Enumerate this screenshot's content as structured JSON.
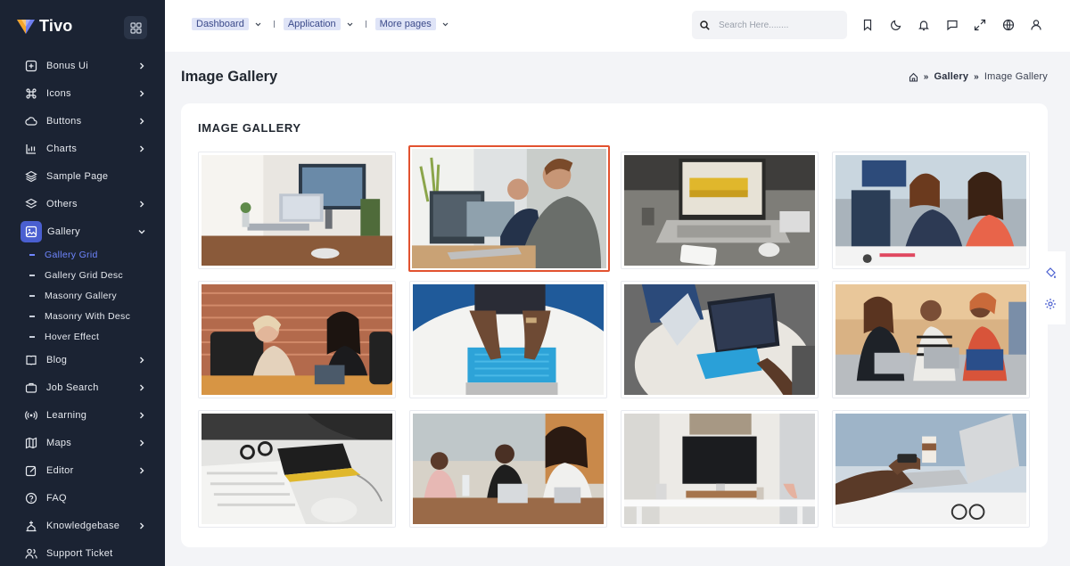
{
  "brand": {
    "name": "Tivo"
  },
  "sidebar": {
    "items": [
      {
        "label": "Bonus Ui",
        "icon": "bonus-ui-icon",
        "chevron": true
      },
      {
        "label": "Icons",
        "icon": "command-icon",
        "chevron": true
      },
      {
        "label": "Buttons",
        "icon": "cloud-icon",
        "chevron": true
      },
      {
        "label": "Charts",
        "icon": "chart-icon",
        "chevron": true
      },
      {
        "label": "Sample Page",
        "icon": "layers-icon",
        "chevron": false
      },
      {
        "label": "Others",
        "icon": "stack-icon",
        "chevron": true
      },
      {
        "label": "Gallery",
        "icon": "image-icon",
        "chevron": true,
        "expanded": true
      }
    ],
    "gallery_sub": [
      {
        "label": "Gallery Grid",
        "active": true
      },
      {
        "label": "Gallery Grid Desc"
      },
      {
        "label": "Masonry Gallery"
      },
      {
        "label": "Masonry With Desc"
      },
      {
        "label": "Hover Effect"
      }
    ],
    "items_after": [
      {
        "label": "Blog",
        "icon": "book-icon",
        "chevron": true
      },
      {
        "label": "Job Search",
        "icon": "briefcase-icon",
        "chevron": true
      },
      {
        "label": "Learning",
        "icon": "broadcast-icon",
        "chevron": true
      },
      {
        "label": "Maps",
        "icon": "map-icon",
        "chevron": true
      },
      {
        "label": "Editor",
        "icon": "edit-icon",
        "chevron": true
      },
      {
        "label": "FAQ",
        "icon": "help-icon",
        "chevron": false
      },
      {
        "label": "Knowledgebase",
        "icon": "knowledge-icon",
        "chevron": true
      },
      {
        "label": "Support Ticket",
        "icon": "users-icon",
        "chevron": false
      }
    ]
  },
  "header": {
    "nav": [
      "Dashboard",
      "Application",
      "More pages"
    ],
    "search_placeholder": "Search Here........",
    "icons": [
      "bookmark-icon",
      "moon-icon",
      "bell-icon",
      "chat-icon",
      "fullscreen-icon",
      "globe-icon",
      "user-icon"
    ]
  },
  "page": {
    "title": "Image Gallery",
    "breadcrumb": [
      "Gallery",
      "Image Gallery"
    ]
  },
  "card": {
    "title": "IMAGE GALLERY",
    "images": [
      {
        "desc": "Desk with monitors and laptop",
        "selected": false
      },
      {
        "desc": "Two men at computers",
        "selected": true
      },
      {
        "desc": "Laptop on desk with yellow sofa",
        "selected": false
      },
      {
        "desc": "Women in meeting",
        "selected": false
      },
      {
        "desc": "Two women at table",
        "selected": false
      },
      {
        "desc": "Hands on blue keyboard",
        "selected": false
      },
      {
        "desc": "Tablet with blue keyboard",
        "selected": false
      },
      {
        "desc": "Women with laptops on sofa",
        "selected": false
      },
      {
        "desc": "Keyboard, notebook and glasses",
        "selected": false
      },
      {
        "desc": "Team meeting in office",
        "selected": false
      },
      {
        "desc": "Monitor on white desk",
        "selected": false
      },
      {
        "desc": "Laptop with coffee cup",
        "selected": false
      }
    ]
  },
  "colors": {
    "sidebar_bg": "#1b2333",
    "accent": "#4a5fd0",
    "active_link": "#6f86ff",
    "selected_border": "#e2522f"
  }
}
